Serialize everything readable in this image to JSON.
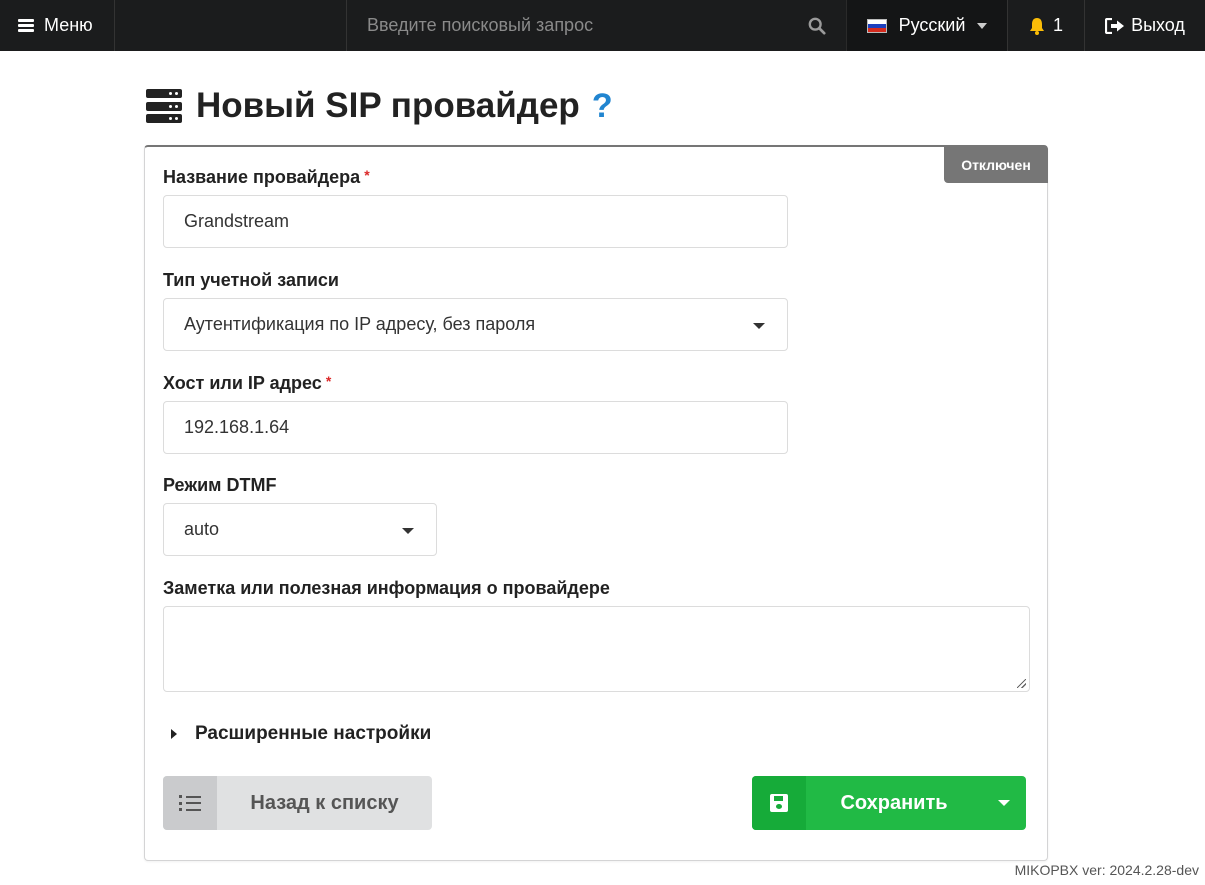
{
  "topbar": {
    "menu_label": "Меню",
    "search_placeholder": "Введите поисковый запрос",
    "language": "Русский",
    "notifications_count": "1",
    "logout_label": "Выход"
  },
  "page": {
    "title": "Новый SIP провайдер",
    "help": "?"
  },
  "form": {
    "status": "Отключен",
    "provider_name": {
      "label": "Название провайдера",
      "required_mark": "*",
      "value": "Grandstream"
    },
    "account_type": {
      "label": "Тип учетной записи",
      "value": "Аутентификация по IP адресу, без пароля"
    },
    "host": {
      "label": "Хост или IP адрес",
      "required_mark": "*",
      "value": "192.168.1.64"
    },
    "dtmf": {
      "label": "Режим DTMF",
      "value": "auto"
    },
    "note": {
      "label": "Заметка или полезная информация о провайдере",
      "value": ""
    },
    "advanced_label": "Расширенные настройки",
    "back_label": "Назад к списку",
    "save_label": "Сохранить"
  },
  "footer": {
    "version": "MIKOPBX ver: 2024.2.28-dev"
  },
  "colors": {
    "topbar": "#1b1c1d",
    "save": "#21ba45",
    "status_badge": "#767676",
    "help": "#2185d0",
    "required": "#db2828"
  }
}
